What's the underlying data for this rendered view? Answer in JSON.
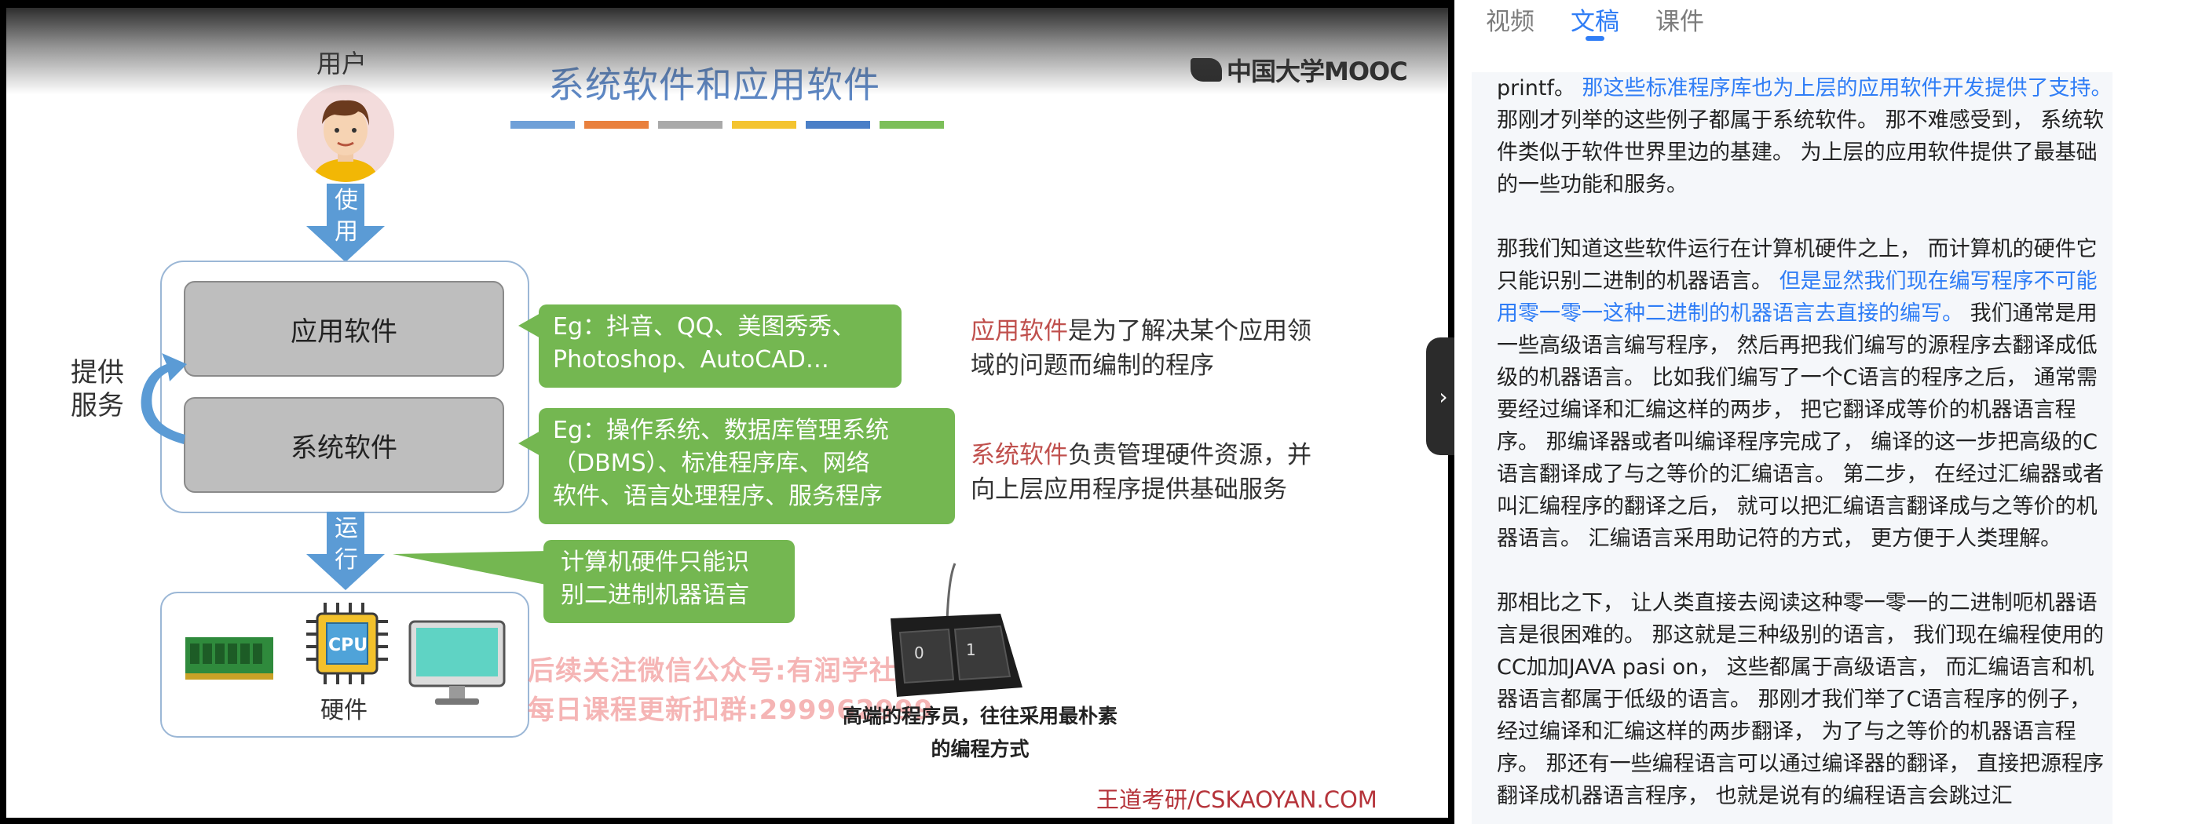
{
  "slide": {
    "title": "系统软件和应用软件",
    "brand": "中国大学MOOC",
    "color_bars": [
      "#6fa0d8",
      "#e9803d",
      "#a9a9a9",
      "#f4c430",
      "#4a7fc7",
      "#7cbf59"
    ],
    "user_label": "用户",
    "use_arrow_text": "使\n用",
    "app_software": "应用软件",
    "system_software": "系统软件",
    "provide_service": "提供\n服务",
    "app_examples": "Eg：抖音、QQ、美图秀秀、\nPhotoshop、AutoCAD…",
    "sys_examples": "Eg：操作系统、数据库管理系统\n（DBMS）、标准程序库、网络\n软件、语言处理程序、服务程序",
    "app_def_term": "应用软件",
    "app_def_rest": "是为了解决某个应用领\n域的问题而编制的程序",
    "sys_def_term": "系统软件",
    "sys_def_rest": "负责管理硬件资源，并\n向上层应用程序提供基础服务",
    "run_arrow_text": "运\n行",
    "hw_note": "计算机硬件只能识\n别二进制机器语言",
    "hardware_label": "硬件",
    "cpu_label": "CPU",
    "watermark_line1": "后续关注微信公众号:有润学社",
    "watermark_line2": "每日课程更新扣群:299962999",
    "keypad_keys": [
      "0",
      "1"
    ],
    "caption": "高端的程序员，往往采用最朴素\n的编程方式",
    "footer_brand": "王道考研/CSKAOYAN.COM"
  },
  "player": {
    "toggle_icon": "chevron-right-icon",
    "toggle_glyph": "›"
  },
  "panel": {
    "tabs": [
      {
        "label": "视频",
        "active": false
      },
      {
        "label": "文稿",
        "active": true
      },
      {
        "label": "课件",
        "active": false
      }
    ],
    "paragraphs": [
      [
        {
          "text": "printf。 ",
          "hl": false
        },
        {
          "text": "那这些标准程序库也为上层的应用软件开发提供了支持。",
          "hl": true
        },
        {
          "text": " 那刚才列举的这些例子都属于系统软件。 那不难感受到， 系统软件类似于软件世界里边的基建。 为上层的应用软件提供了最基础的一些功能和服务。",
          "hl": false
        }
      ],
      [
        {
          "text": "那我们知道这些软件运行在计算机硬件之上， 而计算机的硬件它只能识别二进制的机器语言。 ",
          "hl": false
        },
        {
          "text": "但是显然我们现在编写程序不可能用零一零一这种二进制的机器语言去直接的编写。",
          "hl": true
        },
        {
          "text": " 我们通常是用一些高级语言编写程序， 然后再把我们编写的源程序去翻译成低级的机器语言。 比如我们编写了一个C语言的程序之后， 通常需要经过编译和汇编这样的两步， 把它翻译成等价的机器语言程序。 那编译器或者叫编译程序完成了， 编译的这一步把高级的C语言翻译成了与之等价的汇编语言。 第二步， 在经过汇编器或者叫汇编程序的翻译之后， 就可以把汇编语言翻译成与之等价的机器语言。 汇编语言采用助记符的方式， 更方便于人类理解。",
          "hl": false
        }
      ],
      [
        {
          "text": "那相比之下， 让人类直接去阅读这种零一零一的二进制呃机器语言是很困难的。 那这就是三种级别的语言， 我们现在编程使用的CC加加JAVA pasi on， 这些都属于高级语言， 而汇编语言和机器语言都属于低级的语言。 那刚才我们举了C语言程序的例子， 经过编译和汇编这样的两步翻译， 为了与之等价的机器语言程序。 那还有一些编程语言可以通过编译器的翻译， 直接把源程序翻译成机器语言程序， 也就是说有的编程语言会跳过汇",
          "hl": false
        }
      ]
    ]
  }
}
